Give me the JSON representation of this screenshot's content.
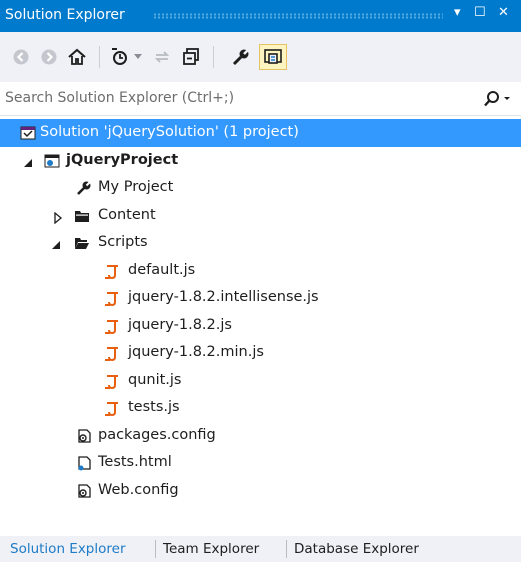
{
  "window": {
    "title": "Solution Explorer",
    "controls": {
      "dropdown": "▾",
      "maximize": "☐",
      "close": "✕"
    },
    "accent_color": "#007acc"
  },
  "toolbar": {
    "buttons": [
      {
        "name": "back-icon"
      },
      {
        "name": "forward-icon"
      },
      {
        "name": "home-icon"
      },
      {
        "name": "pending-changes-filter-icon"
      },
      {
        "name": "sync-with-active-document-icon"
      },
      {
        "name": "collapse-all-icon"
      },
      {
        "name": "properties-icon"
      },
      {
        "name": "preview-selected-items-icon"
      }
    ]
  },
  "search": {
    "placeholder": "Search Solution Explorer (Ctrl+;)"
  },
  "tree": {
    "selected_color": "#3399ff",
    "rows": [
      {
        "label": "Solution 'jQuerySolution' (1 project)",
        "icon": "solution-icon",
        "selected": true
      },
      {
        "label": "jQueryProject",
        "icon": "web-project-icon",
        "bold": true,
        "expanded": true
      },
      {
        "label": "My Project",
        "icon": "wrench-icon"
      },
      {
        "label": "Content",
        "icon": "folder-icon",
        "expanded": false
      },
      {
        "label": "Scripts",
        "icon": "folder-open-icon",
        "expanded": true
      },
      {
        "label": "default.js",
        "icon": "js-file-icon"
      },
      {
        "label": "jquery-1.8.2.intellisense.js",
        "icon": "js-file-icon"
      },
      {
        "label": "jquery-1.8.2.js",
        "icon": "js-file-icon"
      },
      {
        "label": "jquery-1.8.2.min.js",
        "icon": "js-file-icon"
      },
      {
        "label": "qunit.js",
        "icon": "js-file-icon"
      },
      {
        "label": "tests.js",
        "icon": "js-file-icon"
      },
      {
        "label": "packages.config",
        "icon": "config-file-icon"
      },
      {
        "label": "Tests.html",
        "icon": "html-file-icon"
      },
      {
        "label": "Web.config",
        "icon": "config-file-icon"
      }
    ]
  },
  "tabs": [
    {
      "label": "Solution Explorer",
      "active": true
    },
    {
      "label": "Team Explorer",
      "active": false
    },
    {
      "label": "Database Explorer",
      "active": false
    }
  ]
}
